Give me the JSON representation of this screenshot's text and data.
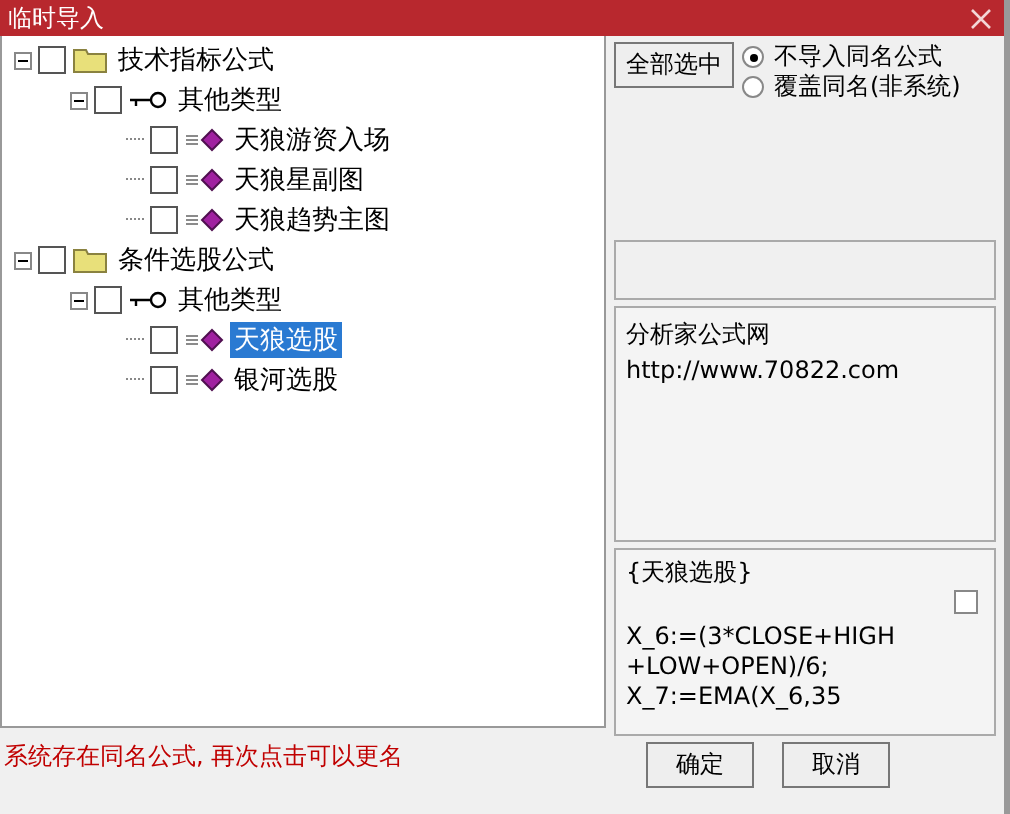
{
  "window": {
    "title": "临时导入"
  },
  "tree": [
    {
      "label": "技术指标公式",
      "kind": "folder",
      "expanded": true,
      "checked": false,
      "selected": false,
      "children": [
        {
          "label": "其他类型",
          "kind": "type",
          "expanded": true,
          "checked": false,
          "selected": false,
          "children": [
            {
              "label": "天狼游资入场",
              "kind": "formula",
              "checked": false,
              "selected": false
            },
            {
              "label": "天狼星副图",
              "kind": "formula",
              "checked": false,
              "selected": false
            },
            {
              "label": "天狼趋势主图",
              "kind": "formula",
              "checked": false,
              "selected": false
            }
          ]
        }
      ]
    },
    {
      "label": "条件选股公式",
      "kind": "folder",
      "expanded": true,
      "checked": false,
      "selected": false,
      "children": [
        {
          "label": "其他类型",
          "kind": "type",
          "expanded": true,
          "checked": false,
          "selected": false,
          "children": [
            {
              "label": "天狼选股",
              "kind": "formula",
              "checked": false,
              "selected": true
            },
            {
              "label": "银河选股",
              "kind": "formula",
              "checked": false,
              "selected": false
            }
          ]
        }
      ]
    }
  ],
  "select_all_button": "全部选中",
  "radios": [
    {
      "label": "不导入同名公式",
      "selected": true
    },
    {
      "label": "覆盖同名(非系统)",
      "selected": false
    }
  ],
  "info_lines": [
    "分析家公式网",
    "http://www.70822.com"
  ],
  "formula": {
    "title": "{天狼选股}",
    "checked": false,
    "lines": [
      "X_6:=(3*CLOSE+HIGH",
      "+LOW+OPEN)/6;",
      "X_7:=EMA(X_6,35"
    ]
  },
  "buttons": [
    "确定",
    "取消"
  ],
  "status": "系统存在同名公式, 再次点击可以更名"
}
